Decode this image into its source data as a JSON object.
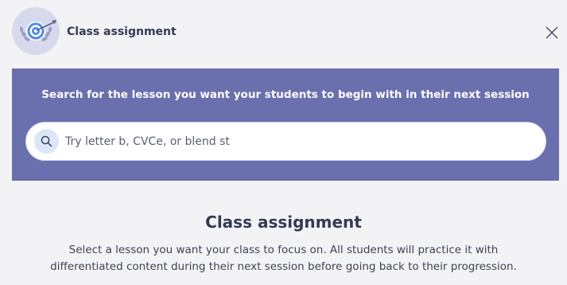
{
  "header": {
    "title": "Class assignment",
    "avatar_icon": "target-icon",
    "close_icon": "close-icon"
  },
  "banner": {
    "heading": "Search for the lesson you want your students to begin with in their next session",
    "search": {
      "placeholder": "Try letter b, CVCe, or blend st",
      "value": "",
      "icon": "search-icon"
    },
    "background": "#6a6fae"
  },
  "section": {
    "title": "Class assignment",
    "description_line1": "Select a lesson you want your class to focus on. All students will practice it with",
    "description_line2": "differentiated content during their next session before going back to their progression."
  }
}
